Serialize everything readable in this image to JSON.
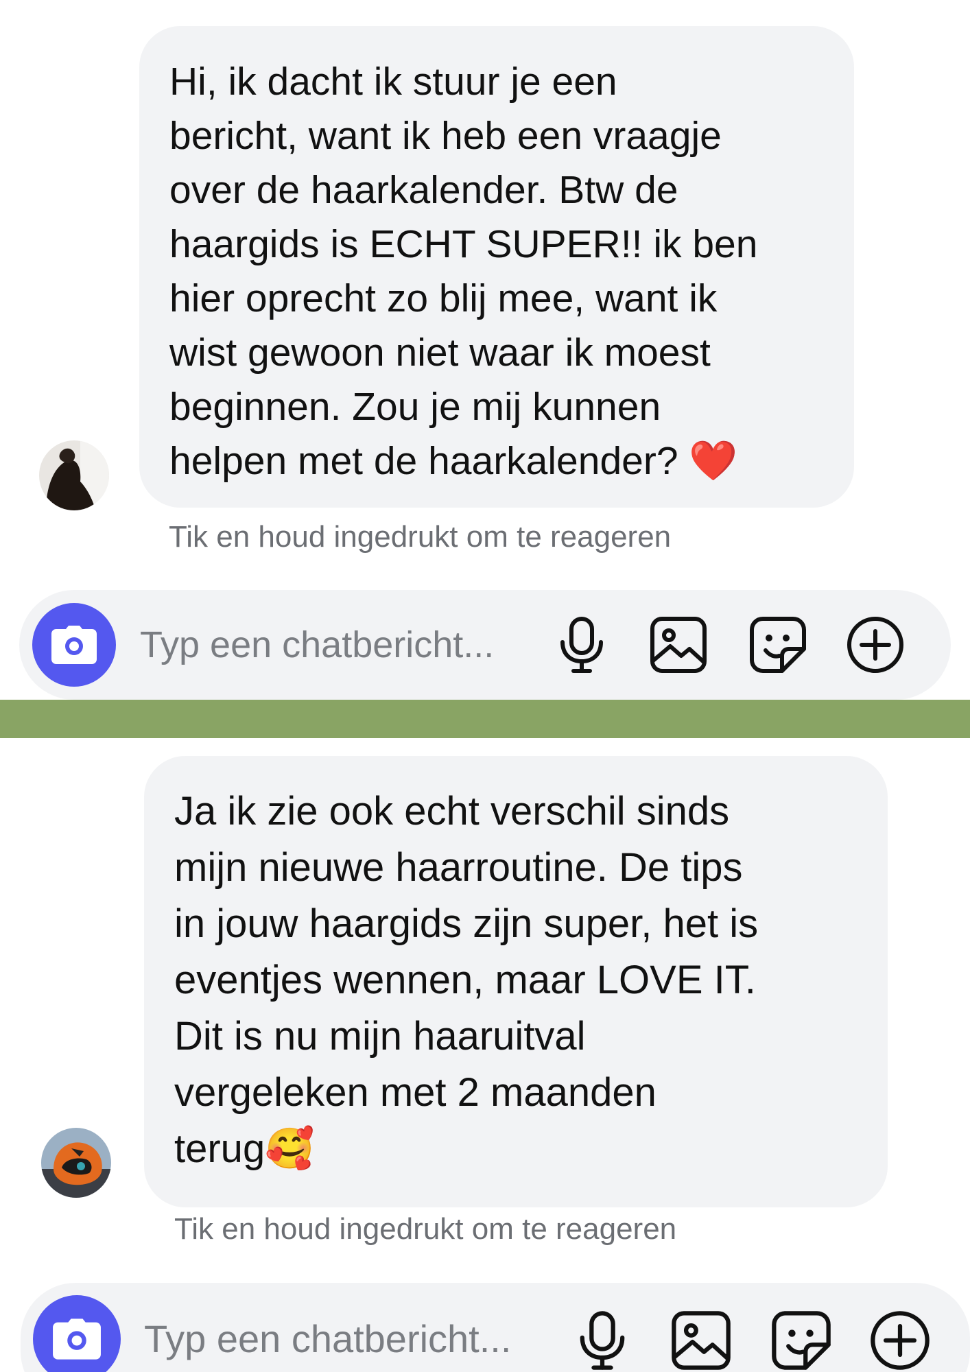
{
  "conversations": [
    {
      "message": {
        "text": "Hi, ik dacht ik stuur je een\nbericht, want ik heb een vraagje\nover de haarkalender. Btw de\nhaargids is ECHT SUPER!! ik ben\nhier oprecht zo blij mee, want ik\nwist gewoon niet waar ik moest\nbeginnen. Zou je mij kunnen\nhelpen met de haarkalender? ",
        "emoji": "❤️"
      },
      "hint": "Tik en houd ingedrukt om te reageren",
      "composer": {
        "placeholder": "Typ een chatbericht..."
      }
    },
    {
      "message": {
        "text": "Ja ik zie ook echt verschil sinds\nmijn nieuwe haarroutine. De tips\nin jouw haargids zijn super, het is\neventjes wennen, maar LOVE IT.\nDit is nu mijn haaruitval\nvergeleken met 2 maanden\nterug",
        "emoji": "🥰"
      },
      "hint": "Tik en houd ingedrukt om te reageren",
      "composer": {
        "placeholder": "Typ een chatbericht..."
      }
    }
  ],
  "icons": {
    "camera": "camera-icon",
    "microphone": "microphone-icon",
    "gallery": "image-icon",
    "sticker": "sticker-icon",
    "more": "plus-circle-icon"
  },
  "colors": {
    "accent": "#5458ef",
    "bubble": "#f2f3f5",
    "divider": "#89a464",
    "hint_text": "#6b6e73"
  }
}
